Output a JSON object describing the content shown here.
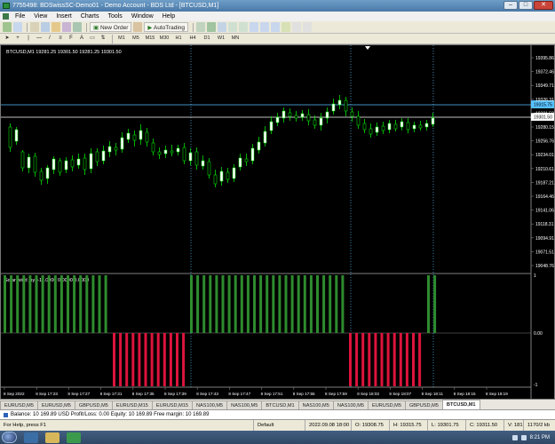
{
  "window": {
    "title": "7755498: BDSwissSC-Demo01 - Demo Account - BDS Ltd - [BTCUSD,M1]",
    "minimize_glyph": "–",
    "maximize_glyph": "□",
    "close_glyph": "✕"
  },
  "menu": [
    "File",
    "View",
    "Insert",
    "Charts",
    "Tools",
    "Window",
    "Help"
  ],
  "toolbar": {
    "new_order": "New Order",
    "autotrading": "AutoTrading",
    "timeframes": [
      "M1",
      "M5",
      "M15",
      "M30",
      "H1",
      "H4",
      "D1",
      "W1",
      "MN"
    ],
    "text_tool": "A"
  },
  "chart": {
    "symbol_info": "BTCUSD,M1  19281.25 19301.50 19281.25 19301.50",
    "indicator_info": "Solar wind joy +11.0000 0.0000 0.0000",
    "price_labels": [
      "19395.86",
      "19372.46",
      "19349.71",
      "19326.31",
      "19301.50",
      "19280.15",
      "19256.76",
      "19234.01",
      "19210.61",
      "19187.21",
      "19164.46",
      "19141.06",
      "19118.31",
      "19094.91",
      "19071.51",
      "19048.76"
    ],
    "bid_label": "19301.50",
    "ask_label": "19315.75",
    "indicator_labels": [
      "1",
      "0.00",
      "-1"
    ],
    "time_labels": [
      "8 Sep 2022",
      "8 Sep 17:23",
      "8 Sep 17:27",
      "8 Sep 17:31",
      "8 Sep 17:35",
      "8 Sep 17:39",
      "8 Sep 17:43",
      "8 Sep 17:47",
      "8 Sep 17:51",
      "8 Sep 17:55",
      "8 Sep 17:59",
      "8 Sep 18:03",
      "8 Sep 18:07",
      "8 Sep 18:11",
      "8 Sep 18:15",
      "8 Sep 18:19"
    ],
    "colors": {
      "background": "#000000",
      "bull_candle": "#ffffff",
      "bear_candle": "#000000",
      "wick": "#00ff00",
      "bid_line": "#ffffff",
      "ask_line": "#57c0ff",
      "histogram_positive": "#2e8b2e",
      "histogram_negative": "#dc143c"
    }
  },
  "tabs": [
    "EURUSD,M5",
    "EURUSD,M5",
    "GBPUSD,M5",
    "EURUSD,M15",
    "EURUSD,M15",
    "NAS100,M5",
    "NAS100,M5",
    "BTCUSD,M1",
    "NAS100,M5",
    "NAS100,M5",
    "EURUSD,M5",
    "GBPUSD,M5",
    "BTCUSD,M1"
  ],
  "active_tab_index": 12,
  "terminal": {
    "balance_line": "Balance: 10 169.89 USD  Profit/Loss: 0.00  Equity: 10 169.89  Free margin: 10 169.89"
  },
  "status": {
    "help": "For Help, press F1",
    "profile": "Default",
    "datetime": "2022.09.08 18:00",
    "open": "O: 19308.75",
    "high": "H: 19315.75",
    "low": "L: 19301.75",
    "close": "C: 19311.50",
    "volume": "V: 181",
    "traffic": "1170/2 kb"
  },
  "taskbar": {
    "time": "8:21 PM"
  }
}
